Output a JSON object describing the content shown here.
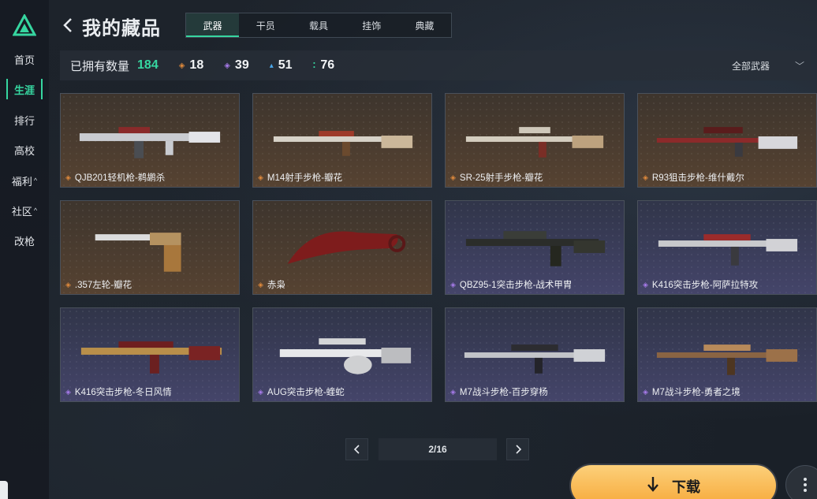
{
  "sidebar": {
    "items": [
      {
        "label": "首页"
      },
      {
        "label": "生涯",
        "active": true
      },
      {
        "label": "排行"
      },
      {
        "label": "高校"
      },
      {
        "label": "福利",
        "caret": "^"
      },
      {
        "label": "社区",
        "caret": "^"
      },
      {
        "label": "改枪"
      }
    ]
  },
  "header": {
    "title": "我的藏品",
    "tabs": [
      {
        "label": "武器",
        "active": true
      },
      {
        "label": "干员"
      },
      {
        "label": "载具"
      },
      {
        "label": "挂饰"
      },
      {
        "label": "典藏"
      }
    ]
  },
  "stats": {
    "label": "已拥有数量",
    "total": "184",
    "counts": [
      {
        "icon": "orange-diamond-icon",
        "value": "18"
      },
      {
        "icon": "purple-diamond-icon",
        "value": "39"
      },
      {
        "icon": "blue-diamond-icon",
        "value": "51"
      },
      {
        "icon": "green-dots-icon",
        "value": "76"
      }
    ],
    "filter": "全部武器"
  },
  "items": [
    {
      "name": "QJB201轻机枪-鹈鹕杀",
      "rarity": "gold"
    },
    {
      "name": "M14射手步枪-瓣花",
      "rarity": "gold"
    },
    {
      "name": "SR-25射手步枪-瓣花",
      "rarity": "gold"
    },
    {
      "name": "R93狙击步枪-维什戴尔",
      "rarity": "gold"
    },
    {
      "name": ".357左轮-瓣花",
      "rarity": "gold"
    },
    {
      "name": "赤枭",
      "rarity": "gold"
    },
    {
      "name": "QBZ95-1突击步枪-战术甲胄",
      "rarity": "purple"
    },
    {
      "name": "K416突击步枪-阿萨拉特攻",
      "rarity": "purple"
    },
    {
      "name": "K416突击步枪-冬日风情",
      "rarity": "purple"
    },
    {
      "name": "AUG突击步枪-蝰蛇",
      "rarity": "purple"
    },
    {
      "name": "M7战斗步枪-百步穿杨",
      "rarity": "purple"
    },
    {
      "name": "M7战斗步枪-勇者之境",
      "rarity": "purple"
    }
  ],
  "pagination": {
    "display": "2/16"
  },
  "download": {
    "label": "下载"
  },
  "colors": {
    "accent": "#36d6a0",
    "download": "#f7a93a",
    "gold": "#e08a3c",
    "purple": "#a77bea",
    "blue": "#4aa6e8"
  }
}
